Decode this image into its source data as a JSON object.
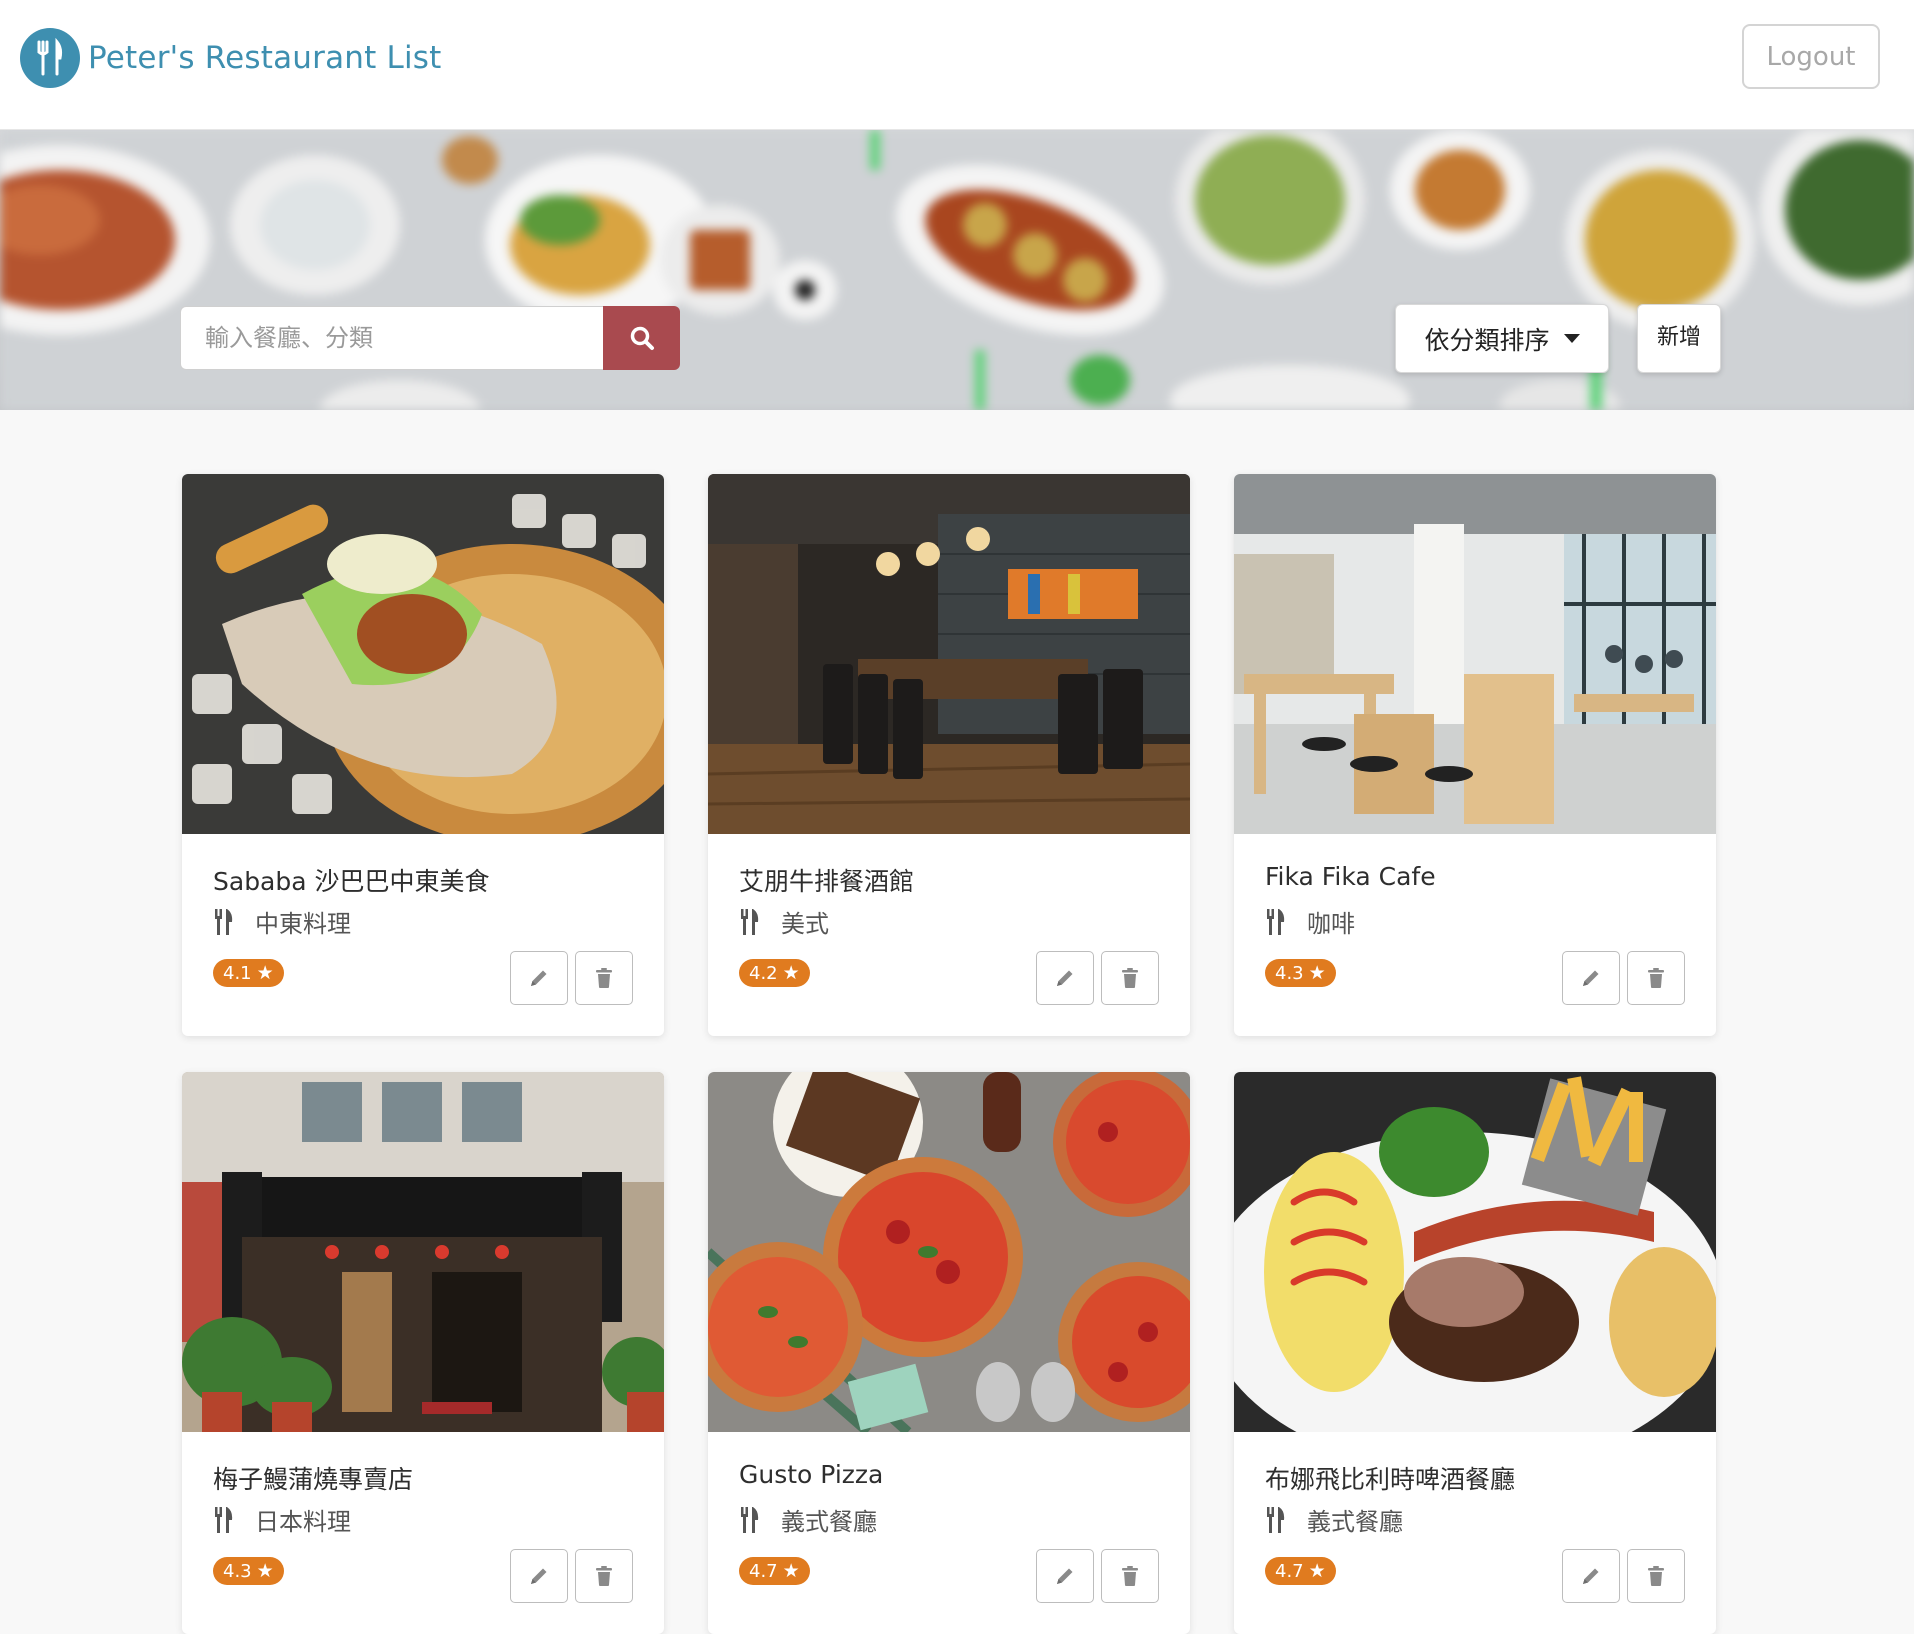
{
  "brand": {
    "title": "Peter's Restaurant List"
  },
  "nav": {
    "logout_label": "Logout"
  },
  "search": {
    "placeholder": "輸入餐廳、分類",
    "value": ""
  },
  "sort": {
    "label": "依分類排序"
  },
  "add": {
    "label": "新增"
  },
  "colors": {
    "brand": "#3e8fb0",
    "search_button": "#a94a4f",
    "rating_badge": "#e07b1f"
  },
  "restaurants": [
    {
      "name": "Sababa 沙巴巴中東美食",
      "category": "中東料理",
      "rating": "4.1"
    },
    {
      "name": "艾朋牛排餐酒館",
      "category": "美式",
      "rating": "4.2"
    },
    {
      "name": "Fika Fika Cafe",
      "category": "咖啡",
      "rating": "4.3"
    },
    {
      "name": "梅子鰻蒲燒專賣店",
      "category": "日本料理",
      "rating": "4.3"
    },
    {
      "name": "Gusto Pizza",
      "category": "義式餐廳",
      "rating": "4.7"
    },
    {
      "name": "布娜飛比利時啤酒餐廳",
      "category": "義式餐廳",
      "rating": "4.7"
    }
  ]
}
